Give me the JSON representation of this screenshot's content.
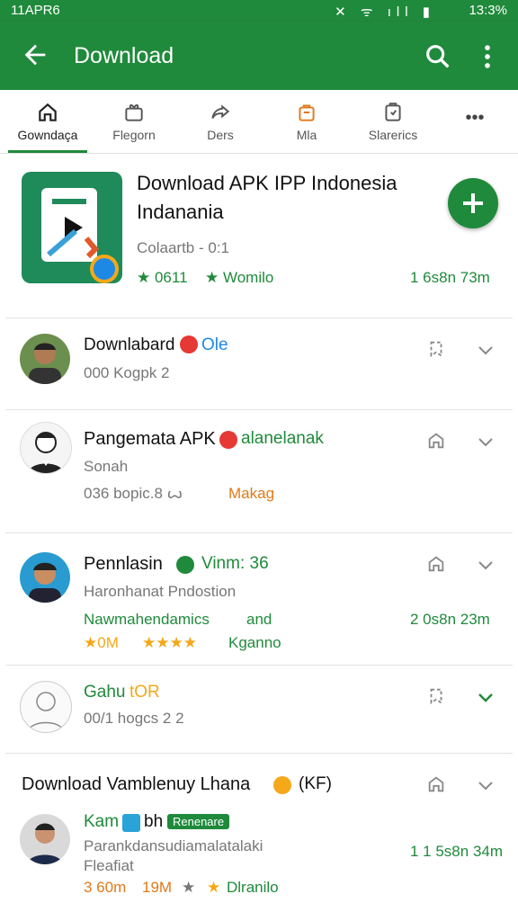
{
  "status_bar": {
    "time": "11APR6",
    "battery": "13:3%",
    "icons": "✕ ᯤ ıll ▮"
  },
  "app_bar": {
    "title": "Download"
  },
  "tabs": [
    {
      "label": "Gowndaça",
      "icon": "home-icon"
    },
    {
      "label": "Flegorn",
      "icon": "gift-icon"
    },
    {
      "label": "Ders",
      "icon": "share-icon"
    },
    {
      "label": "Mla",
      "icon": "bag-icon"
    },
    {
      "label": "Slarerics",
      "icon": "clipboard-icon"
    },
    {
      "label": "•••",
      "icon": "more-icon"
    }
  ],
  "featured": {
    "title_line1": "Download APK IPP Indonesia",
    "title_line2": "Indanania",
    "subtitle": "Colaartb - 0:1",
    "rating": "★ 0611",
    "tag": "★ Womilo",
    "meta": "1 6s8n 73m"
  },
  "items": [
    {
      "name": "Downlabard",
      "badge": "Ole",
      "line2": "000 Kogpk 2",
      "line3": "",
      "line4": "",
      "meta": ""
    },
    {
      "name": "Pangemata APK",
      "badge": "alanelanak",
      "line2": "Sonah",
      "line3": "036 bopic.8 ꙍ",
      "line3b": "Makag",
      "meta": ""
    },
    {
      "name": "Pennlasin",
      "badge": "Vinm: 36",
      "line2": "Haronhanat Pndostion",
      "line3": "Nawmahendamics",
      "line3b": "and",
      "rating": "★0M",
      "stars": "★★★★",
      "tag": "Kganno",
      "meta": "2 0s8n 23m"
    },
    {
      "name": "Gahu",
      "badge": "tOR",
      "line2": "00/1 hogcs 2 2"
    },
    {
      "name": "Download Vamblenuy Lhana",
      "badge": "(KF)",
      "subname": "Kam",
      "subname2": "bh",
      "chip": "Renenare",
      "line2": "Parankdansudiamalatalaki",
      "line3": "Fleafiat",
      "rating": "3 60m",
      "rating2": "19M",
      "tag": "Dlranilo",
      "meta": "1 1 5s8n 34m"
    }
  ],
  "colors": {
    "primary": "#1f8a3b",
    "accent": "#e07a1a",
    "star": "#f4a81a"
  }
}
